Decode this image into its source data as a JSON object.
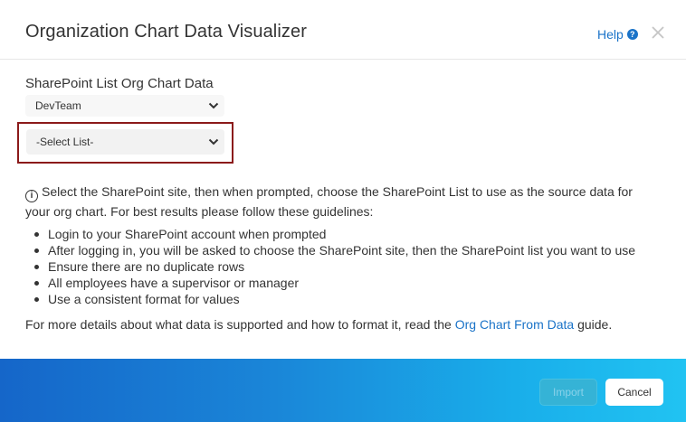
{
  "dialog": {
    "title": "Organization Chart Data Visualizer",
    "help_label": "Help",
    "help_icon": "question-circle-icon",
    "close_icon": "close-icon"
  },
  "form": {
    "section_label": "SharePoint List Org Chart Data",
    "site_select_value": "DevTeam",
    "list_select_value": "-Select List-"
  },
  "info": {
    "intro": "Select the SharePoint site, then when prompted, choose the SharePoint List to use as the source data for your org chart. For best results please follow these guidelines:",
    "guidelines": [
      "Login to your SharePoint account when prompted",
      "After logging in, you will be asked to choose the SharePoint site, then the SharePoint list you want to use",
      "Ensure there are no duplicate rows",
      "All employees have a supervisor or manager",
      "Use a consistent format for values"
    ],
    "more_prefix": "For more details about what data is supported and how to format it, read the ",
    "more_link": "Org Chart From Data",
    "more_suffix": " guide."
  },
  "footer": {
    "import_label": "Import",
    "cancel_label": "Cancel"
  },
  "colors": {
    "accent": "#1a73c8",
    "highlight_border": "#8b1a1a",
    "footer_start": "#1566c9",
    "footer_end": "#21c3f2"
  }
}
